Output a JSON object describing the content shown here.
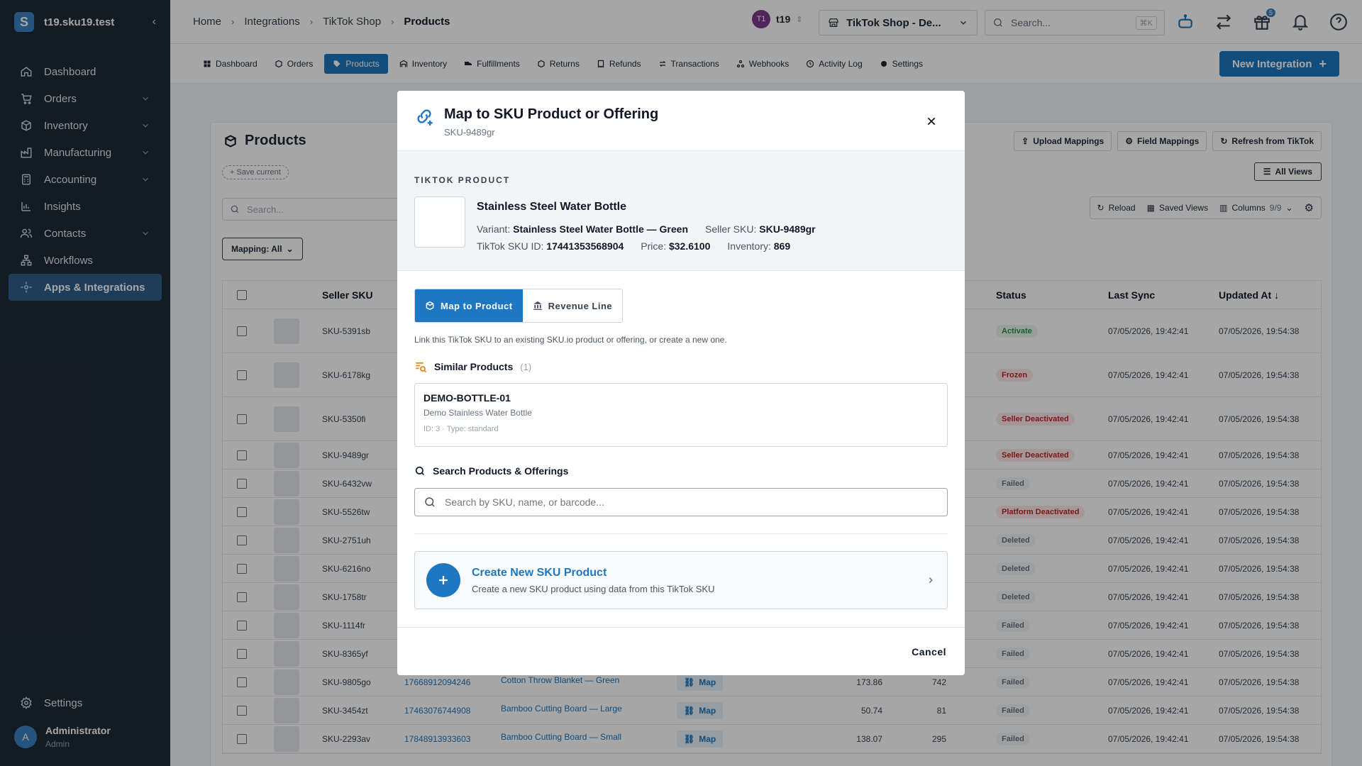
{
  "sidebar": {
    "org": "t19.sku19.test",
    "items": [
      {
        "label": "Dashboard",
        "icon": "home-icon"
      },
      {
        "label": "Orders",
        "icon": "cart-icon"
      },
      {
        "label": "Inventory",
        "icon": "box-icon"
      },
      {
        "label": "Manufacturing",
        "icon": "factory-icon"
      },
      {
        "label": "Accounting",
        "icon": "calculator-icon"
      },
      {
        "label": "Insights",
        "icon": "chart-icon"
      },
      {
        "label": "Contacts",
        "icon": "users-icon"
      },
      {
        "label": "Workflows",
        "icon": "workflow-icon"
      },
      {
        "label": "Apps & Integrations",
        "icon": "apps-icon"
      }
    ],
    "settings": "Settings",
    "user": {
      "initial": "A",
      "name": "Administrator",
      "role": "Admin"
    }
  },
  "topbar": {
    "breadcrumbs": [
      "Home",
      "Integrations",
      "TikTok Shop",
      "Products"
    ],
    "store_initials": "T1",
    "store_name": "t19",
    "shop": "TikTok Shop - De...",
    "search_placeholder": "Search...",
    "search_shortcut": "⌘K",
    "gift_badge": "5"
  },
  "tabs": [
    "Dashboard",
    "Orders",
    "Products",
    "Inventory",
    "Fulfillments",
    "Returns",
    "Refunds",
    "Transactions",
    "Webhooks",
    "Activity Log",
    "Settings"
  ],
  "new_integration": "New Integration",
  "products": {
    "title": "Products",
    "save_current": "+ Save current",
    "search_placeholder": "Search...",
    "mapping_filter": "Mapping: All",
    "buttons": {
      "upload": "Upload Mappings",
      "field": "Field Mappings",
      "refresh": "Refresh from TikTok"
    },
    "all_views": "All Views",
    "toolbar": {
      "reload": "Reload",
      "saved_views": "Saved Views",
      "columns": "Columns",
      "columns_count": "9/9"
    },
    "headers": {
      "seller_sku": "Seller SKU",
      "status": "Status",
      "last_sync": "Last Sync",
      "updated_at": "Updated At"
    },
    "rows": [
      {
        "sku": "SKU-5391sb",
        "id": "",
        "title": "",
        "price": "",
        "inv": "",
        "status": "Activate",
        "st": "green",
        "last": "07/05/2026, 19:42:41",
        "upd": "07/05/2026, 19:54:38"
      },
      {
        "sku": "SKU-6178kg",
        "id": "",
        "title": "",
        "price": "",
        "inv": "",
        "status": "Frozen",
        "st": "red",
        "last": "07/05/2026, 19:42:41",
        "upd": "07/05/2026, 19:54:38"
      },
      {
        "sku": "SKU-5350fi",
        "id": "",
        "title": "",
        "price": "",
        "inv": "",
        "status": "Seller Deactivated",
        "st": "red",
        "last": "07/05/2026, 19:42:41",
        "upd": "07/05/2026, 19:54:38"
      },
      {
        "sku": "SKU-9489gr",
        "id": "",
        "title": "",
        "price": "",
        "inv": "",
        "status": "Seller Deactivated",
        "st": "red",
        "last": "07/05/2026, 19:42:41",
        "upd": "07/05/2026, 19:54:38"
      },
      {
        "sku": "SKU-6432vw",
        "id": "",
        "title": "",
        "price": "",
        "inv": "",
        "status": "Failed",
        "st": "gray",
        "last": "07/05/2026, 19:42:41",
        "upd": "07/05/2026, 19:54:38"
      },
      {
        "sku": "SKU-5526tw",
        "id": "",
        "title": "",
        "price": "",
        "inv": "",
        "status": "Platform Deactivated",
        "st": "red",
        "last": "07/05/2026, 19:42:41",
        "upd": "07/05/2026, 19:54:38"
      },
      {
        "sku": "SKU-2751uh",
        "id": "",
        "title": "",
        "price": "",
        "inv": "",
        "status": "Deleted",
        "st": "gray",
        "last": "07/05/2026, 19:42:41",
        "upd": "07/05/2026, 19:54:38"
      },
      {
        "sku": "SKU-6216no",
        "id": "",
        "title": "",
        "price": "",
        "inv": "",
        "status": "Deleted",
        "st": "gray",
        "last": "07/05/2026, 19:42:41",
        "upd": "07/05/2026, 19:54:38"
      },
      {
        "sku": "SKU-1758tr",
        "id": "",
        "title": "",
        "price": "",
        "inv": "",
        "status": "Deleted",
        "st": "gray",
        "last": "07/05/2026, 19:42:41",
        "upd": "07/05/2026, 19:54:38"
      },
      {
        "sku": "SKU-1114fr",
        "id": "",
        "title": "",
        "price": "",
        "inv": "",
        "status": "Failed",
        "st": "gray",
        "last": "07/05/2026, 19:42:41",
        "upd": "07/05/2026, 19:54:38"
      },
      {
        "sku": "SKU-8365yf",
        "id": "",
        "title": "",
        "price": "",
        "inv": "",
        "status": "Failed",
        "st": "gray",
        "last": "07/05/2026, 19:42:41",
        "upd": "07/05/2026, 19:54:38"
      },
      {
        "sku": "SKU-9805go",
        "id": "17668912094246",
        "title": "Cotton Throw Blanket — Green",
        "map": "Map",
        "price": "173.86",
        "inv": "742",
        "status": "Failed",
        "st": "gray",
        "last": "07/05/2026, 19:42:41",
        "upd": "07/05/2026, 19:54:38"
      },
      {
        "sku": "SKU-3454zt",
        "id": "17463076744908",
        "title": "Bamboo Cutting Board — Large",
        "map": "Map",
        "price": "50.74",
        "inv": "81",
        "status": "Failed",
        "st": "gray",
        "last": "07/05/2026, 19:42:41",
        "upd": "07/05/2026, 19:54:38"
      },
      {
        "sku": "SKU-2293av",
        "id": "17848913933603",
        "title": "Bamboo Cutting Board — Small",
        "map": "Map",
        "price": "138.07",
        "inv": "295",
        "status": "Failed",
        "st": "gray",
        "last": "07/05/2026, 19:42:41",
        "upd": "07/05/2026, 19:54:38"
      }
    ]
  },
  "modal": {
    "title": "Map to SKU Product or Offering",
    "subtitle": "SKU-9489gr",
    "section_label": "TIKTOK PRODUCT",
    "product_name": "Stainless Steel Water Bottle",
    "variant_label": "Variant:",
    "variant_value": "Stainless Steel Water Bottle — Green",
    "seller_sku_label": "Seller SKU:",
    "seller_sku_value": "SKU-9489gr",
    "sku_id_label": "TikTok SKU ID:",
    "sku_id_value": "17441353568904",
    "price_label": "Price:",
    "price_value": "$32.6100",
    "inventory_label": "Inventory:",
    "inventory_value": "869",
    "seg_map": "Map to Product",
    "seg_revenue": "Revenue Line",
    "description": "Link this TikTok SKU to an existing SKU.io product or offering, or create a new one.",
    "similar_title": "Similar Products",
    "similar_count": "(1)",
    "similar": {
      "sku": "DEMO-BOTTLE-01",
      "name": "Demo Stainless Water Bottle",
      "meta": "ID: 3 · Type: standard"
    },
    "search_title": "Search Products & Offerings",
    "search_placeholder": "Search by SKU, name, or barcode...",
    "create_title": "Create New SKU Product",
    "create_desc": "Create a new SKU product using data from this TikTok SKU",
    "cancel": "Cancel"
  }
}
